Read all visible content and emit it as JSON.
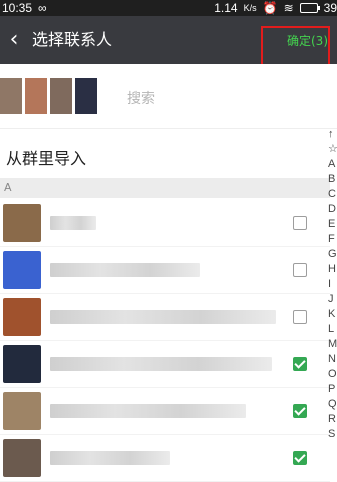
{
  "status_bar": {
    "time": "10:35",
    "left_icon": "infinity-icon",
    "speed": "1.14",
    "speed_unit": "K/s",
    "battery": "39"
  },
  "header": {
    "title": "选择联系人",
    "confirm_label": "确定(3)",
    "back_icon": "chevron-left-icon"
  },
  "search": {
    "placeholder": "搜索",
    "selected_avatar_count": 4
  },
  "import": {
    "label": "从群里导入"
  },
  "section": {
    "letter": "A"
  },
  "contacts": [
    {
      "checked": false,
      "avatar_color": "#8a6a4a"
    },
    {
      "checked": false,
      "avatar_color": "#3a62d0"
    },
    {
      "checked": false,
      "avatar_color": "#a0522d"
    },
    {
      "checked": true,
      "avatar_color": "#222a3d"
    },
    {
      "checked": true,
      "avatar_color": "#9e8466"
    },
    {
      "checked": true,
      "avatar_color": "#6b5a4e"
    }
  ],
  "index_letters": [
    "↑",
    "☆",
    "A",
    "B",
    "C",
    "D",
    "E",
    "F",
    "G",
    "H",
    "I",
    "J",
    "K",
    "L",
    "M",
    "N",
    "O",
    "P",
    "Q",
    "R",
    "S"
  ],
  "colors": {
    "titlebar": "#393a3f",
    "confirm": "#44d44f",
    "highlight": "#e21c1c",
    "check": "#34a853"
  }
}
